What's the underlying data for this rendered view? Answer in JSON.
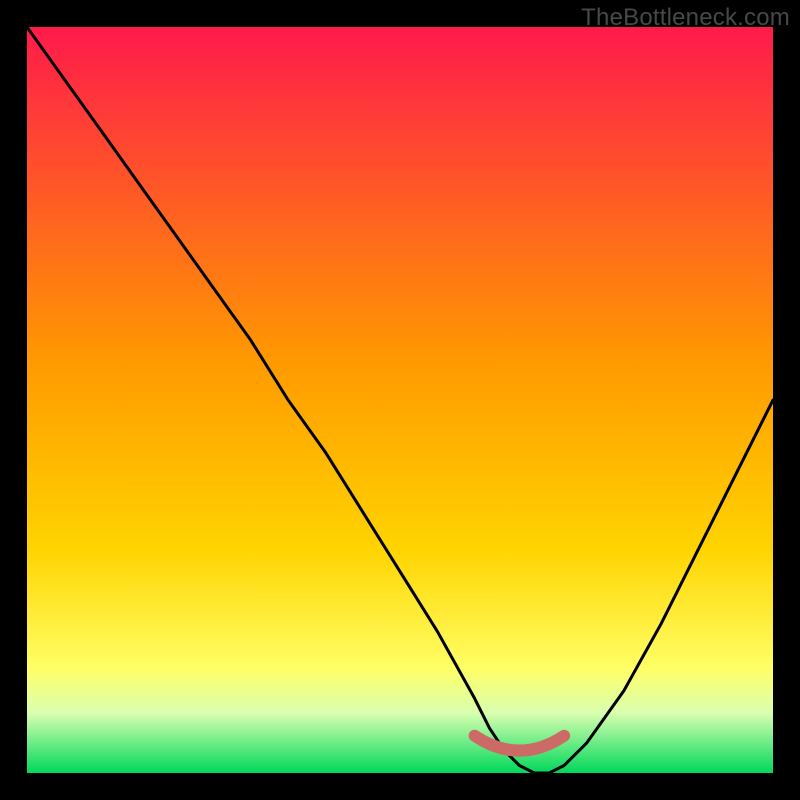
{
  "watermark": "TheBottleneck.com",
  "colors": {
    "top": "#ff1a4b",
    "mid": "#ffd400",
    "low_yellow": "#ffff66",
    "pale_green": "#d8ffb0",
    "green": "#00d85a",
    "curve": "#000000",
    "marker": "#cc6b66"
  },
  "chart_data": {
    "type": "line",
    "title": "",
    "xlabel": "",
    "ylabel": "",
    "xlim": [
      0,
      100
    ],
    "ylim": [
      0,
      100
    ],
    "series": [
      {
        "name": "bottleneck-curve",
        "x": [
          0,
          5,
          10,
          15,
          20,
          25,
          30,
          35,
          40,
          45,
          50,
          55,
          60,
          62,
          64,
          66,
          68,
          70,
          72,
          75,
          80,
          85,
          90,
          95,
          100
        ],
        "y": [
          100,
          93,
          86,
          79,
          72,
          65,
          58,
          50,
          43,
          35,
          27,
          19,
          10,
          6,
          3,
          1,
          0,
          0,
          1,
          4,
          11,
          20,
          30,
          40,
          50
        ]
      }
    ],
    "marker_band": {
      "x_start": 60,
      "x_end": 72,
      "y": 2
    }
  }
}
